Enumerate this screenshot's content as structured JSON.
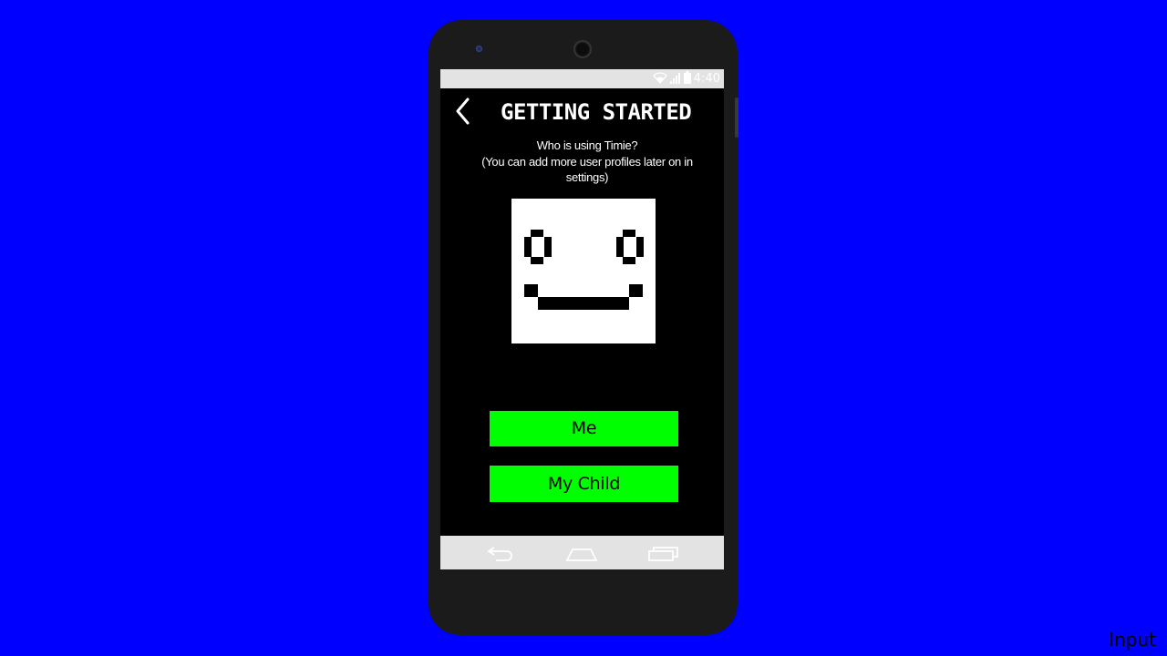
{
  "status_bar": {
    "time": "4:40",
    "icons": [
      "wifi-icon",
      "signal-icon",
      "battery-icon"
    ]
  },
  "header": {
    "back_icon": "chevron-left-icon",
    "title": "GETTING STARTED"
  },
  "prompt": {
    "line1": "Who is using Timie?",
    "line2": "(You can add more user profiles later on in",
    "line3": "settings)"
  },
  "avatar": {
    "icon": "pixel-smiley-face-icon"
  },
  "buttons": {
    "me": "Me",
    "my_child": "My Child"
  },
  "nav_bar": {
    "icons": [
      "back-icon",
      "home-icon",
      "recents-icon"
    ]
  },
  "overlay_label": "Input",
  "colors": {
    "background": "#0000ff",
    "accent": "#00ff00",
    "screen": "#000000",
    "system_bars": "#e3e3e3"
  }
}
